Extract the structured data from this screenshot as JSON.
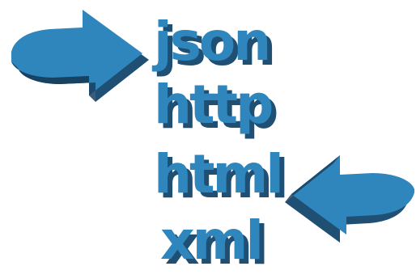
{
  "words": [
    "json",
    "http",
    "html",
    "xml"
  ],
  "colors": {
    "face": "#2f86bd",
    "shadow": "#1f4f73",
    "edge": "#17405e",
    "background": "#ffffff"
  },
  "icons": [
    "arrow-right-3d-icon",
    "arrow-left-3d-icon"
  ]
}
